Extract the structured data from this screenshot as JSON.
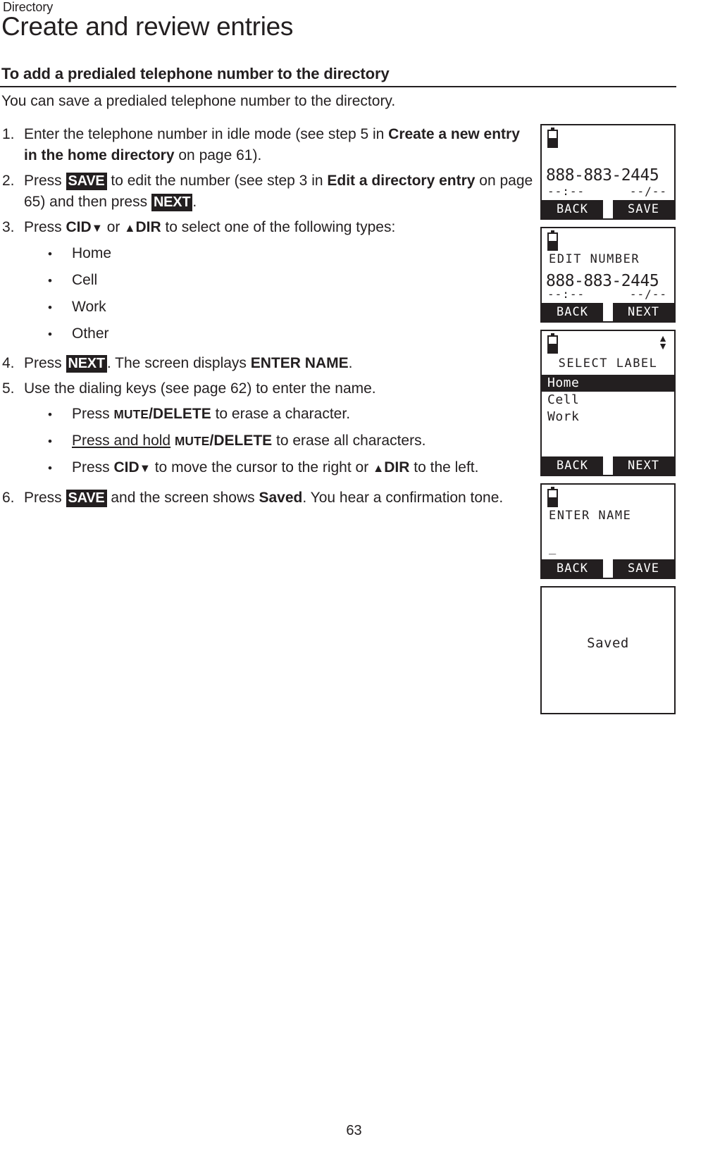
{
  "header": {
    "running_head": "Directory",
    "chapter_title": "Create and review entries"
  },
  "section": {
    "subhead": "To add a predialed telephone number to the directory",
    "intro": "You can save a predialed telephone number to the directory."
  },
  "steps": [
    {
      "num": "1.",
      "parts": [
        {
          "t": "Enter the telephone number in idle mode (see step 5 in ",
          "s": "plain"
        },
        {
          "t": "Create a new entry in the home directory",
          "s": "bold"
        },
        {
          "t": " on page 61).",
          "s": "plain"
        }
      ]
    },
    {
      "num": "2.",
      "parts": [
        {
          "t": "Press ",
          "s": "plain"
        },
        {
          "t": "SAVE",
          "s": "key"
        },
        {
          "t": " to edit the number (see step 3 in ",
          "s": "plain"
        },
        {
          "t": "Edit a directory entry",
          "s": "bold"
        },
        {
          "t": " on page 65) and then press ",
          "s": "plain"
        },
        {
          "t": "NEXT",
          "s": "key"
        },
        {
          "t": ".",
          "s": "plain"
        }
      ]
    },
    {
      "num": "3.",
      "parts": [
        {
          "t": "Press ",
          "s": "plain"
        },
        {
          "t": "CID",
          "s": "bold-tri-down"
        },
        {
          "t": " or ",
          "s": "plain"
        },
        {
          "t": "DIR",
          "s": "tri-up-bold"
        },
        {
          "t": " to select one of the following types:",
          "s": "plain"
        }
      ],
      "bullets": [
        "Home",
        "Cell",
        "Work",
        "Other"
      ]
    },
    {
      "num": "4.",
      "parts": [
        {
          "t": "Press ",
          "s": "plain"
        },
        {
          "t": "NEXT",
          "s": "key"
        },
        {
          "t": ". The screen displays ",
          "s": "plain"
        },
        {
          "t": "ENTER NAME",
          "s": "bold"
        },
        {
          "t": ".",
          "s": "plain"
        }
      ]
    },
    {
      "num": "5.",
      "parts": [
        {
          "t": "Use the dialing keys (see page 62) to enter the name.",
          "s": "plain"
        }
      ],
      "rich_bullets": [
        [
          {
            "t": "Press ",
            "s": "plain"
          },
          {
            "t": "MUTE",
            "s": "smallcaps"
          },
          {
            "t": "/DELETE",
            "s": "bold"
          },
          {
            "t": " to erase a character.",
            "s": "plain"
          }
        ],
        [
          {
            "t": "Press and hold",
            "s": "underline"
          },
          {
            "t": " ",
            "s": "plain"
          },
          {
            "t": "MUTE",
            "s": "smallcaps"
          },
          {
            "t": "/DELETE",
            "s": "bold"
          },
          {
            "t": " to erase all characters.",
            "s": "plain"
          }
        ],
        [
          {
            "t": "Press ",
            "s": "plain"
          },
          {
            "t": "CID",
            "s": "bold-tri-down"
          },
          {
            "t": " to move the cursor to the right or ",
            "s": "plain"
          },
          {
            "t": "DIR",
            "s": "tri-up-bold"
          },
          {
            "t": " to the left.",
            "s": "plain"
          }
        ]
      ]
    },
    {
      "num": "6.",
      "parts": [
        {
          "t": "Press ",
          "s": "plain"
        },
        {
          "t": "SAVE",
          "s": "key"
        },
        {
          "t": " and the screen shows ",
          "s": "plain"
        },
        {
          "t": "Saved",
          "s": "bold"
        },
        {
          "t": ". You hear a confirmation tone.",
          "s": "plain"
        }
      ]
    }
  ],
  "screens": [
    {
      "id": "screen-predial",
      "battery": "battery-icon",
      "number": "888-883-2445",
      "meta_left": "--:--",
      "meta_right": "--/--",
      "softkeys": [
        "BACK",
        "SAVE"
      ]
    },
    {
      "id": "screen-edit-number",
      "battery": "battery-icon",
      "heading": "EDIT NUMBER",
      "number": "888-883-2445",
      "meta_left": "--:--",
      "meta_right": "--/--",
      "softkeys": [
        "BACK",
        "NEXT"
      ]
    },
    {
      "id": "screen-select-label",
      "battery": "battery-icon",
      "scroll_up": "▲",
      "scroll_down": "▼",
      "heading": "SELECT LABEL",
      "list": [
        "Home",
        "Cell",
        "Work"
      ],
      "selected_index": 0,
      "softkeys": [
        "BACK",
        "NEXT"
      ]
    },
    {
      "id": "screen-enter-name",
      "battery": "battery-icon",
      "heading": "ENTER NAME",
      "cursor": "_",
      "softkeys": [
        "BACK",
        "SAVE"
      ]
    },
    {
      "id": "screen-saved",
      "message": "Saved"
    }
  ],
  "footer": {
    "page_number": "63"
  }
}
